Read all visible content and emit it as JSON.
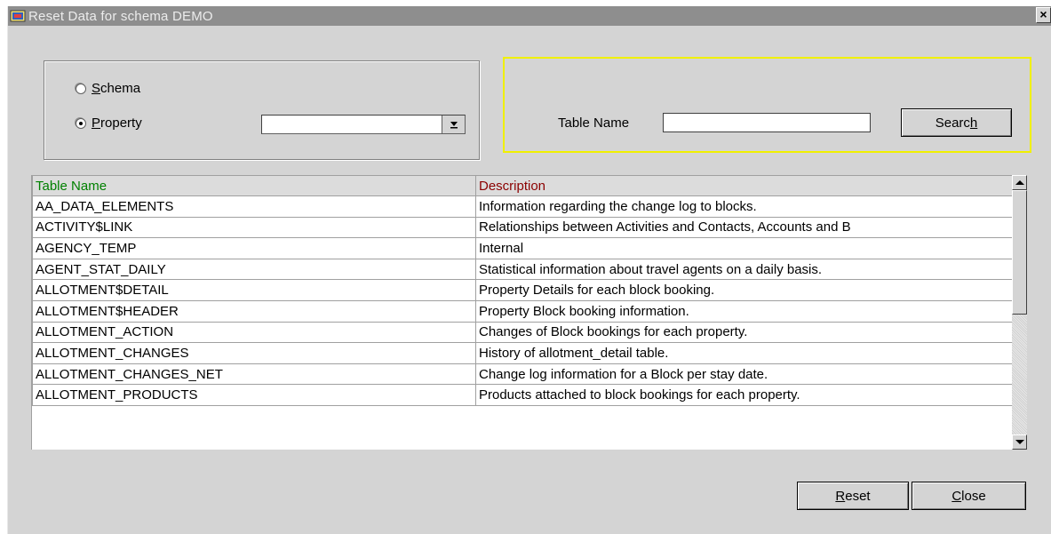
{
  "window": {
    "title": "Reset Data for schema DEMO",
    "close_glyph": "×"
  },
  "selector": {
    "schema_label_m": "S",
    "schema_label_rest": "chema",
    "property_label_m": "P",
    "property_label_rest": "roperty",
    "selected": "property",
    "property_value": "",
    "dropdown_glyph": "⬇"
  },
  "search": {
    "label": "Table Name",
    "value": "",
    "button_label_pre": "Searc",
    "button_label_m": "h"
  },
  "table": {
    "columns": [
      "Table Name",
      "Description"
    ],
    "rows": [
      [
        "AA_DATA_ELEMENTS",
        "Information regarding the change log to blocks."
      ],
      [
        "ACTIVITY$LINK",
        "Relationships between Activities and Contacts, Accounts and B"
      ],
      [
        "AGENCY_TEMP",
        "Internal"
      ],
      [
        "AGENT_STAT_DAILY",
        "Statistical information about travel agents on a daily basis."
      ],
      [
        "ALLOTMENT$DETAIL",
        "Property Details for each block booking."
      ],
      [
        "ALLOTMENT$HEADER",
        "Property Block booking information."
      ],
      [
        "ALLOTMENT_ACTION",
        "Changes of Block bookings for each property."
      ],
      [
        "ALLOTMENT_CHANGES",
        "History of allotment_detail table."
      ],
      [
        "ALLOTMENT_CHANGES_NET",
        "Change log information for a Block per stay date."
      ],
      [
        "ALLOTMENT_PRODUCTS",
        "Products attached to block bookings for each property."
      ]
    ]
  },
  "footer": {
    "reset_m": "R",
    "reset_rest": "eset",
    "close_m": "C",
    "close_rest": "lose"
  },
  "colors": {
    "titlebar": "#8e8e8e",
    "highlight_border": "#f0f000",
    "col1_header": "#008000",
    "col2_header": "#8b0000"
  }
}
